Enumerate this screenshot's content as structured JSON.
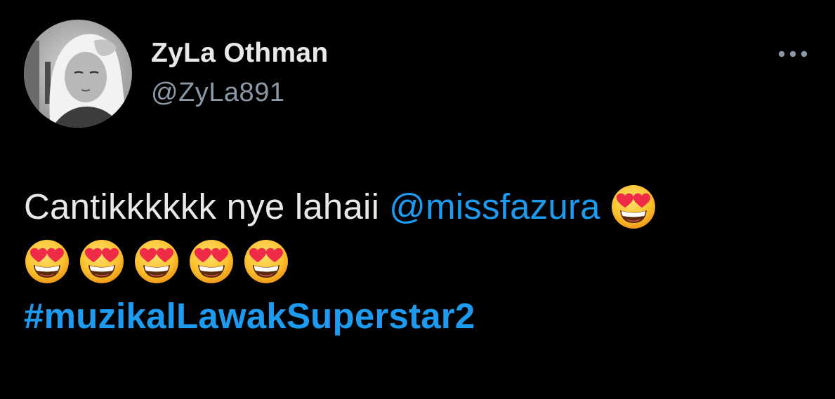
{
  "author": {
    "display_name": "ZyLa Othman",
    "handle": "@ZyLa891",
    "avatar_icon": "profile-photo"
  },
  "menu": {
    "icon": "more-horizontal-icon"
  },
  "tweet": {
    "text_plain": "Cantikkkkkk nye lahaii",
    "mention": "@missfazura",
    "emoji_icon": "smiling-face-with-heart-eyes-emoji",
    "emoji_count": 6,
    "hashtag": "#muzikalLawakSuperstar2"
  },
  "colors": {
    "background": "#000000",
    "text": "#e7e9ea",
    "secondary_text": "#8b98a5",
    "link": "#1d9bf0"
  }
}
